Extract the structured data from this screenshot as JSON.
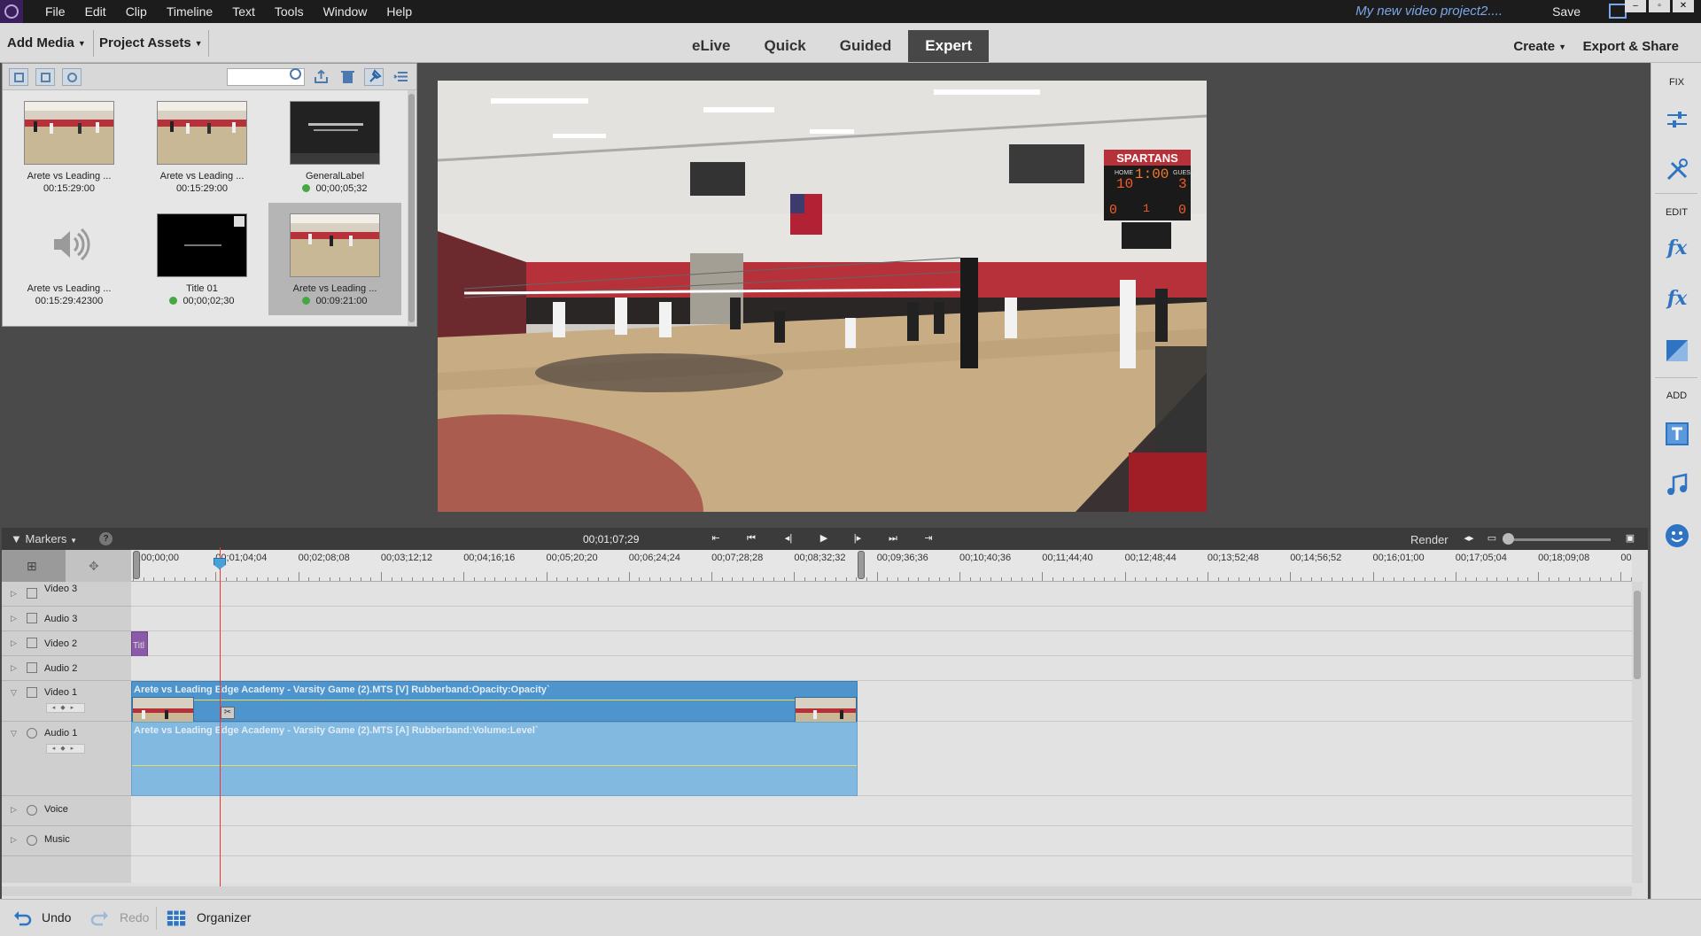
{
  "menu": {
    "items": [
      "File",
      "Edit",
      "Clip",
      "Timeline",
      "Text",
      "Tools",
      "Window",
      "Help"
    ],
    "project_name": "My new video project2....",
    "save": "Save"
  },
  "modebar": {
    "add_media": "Add Media",
    "project_assets": "Project Assets",
    "tabs": [
      "eLive",
      "Quick",
      "Guided",
      "Expert"
    ],
    "active_tab": "Expert",
    "create": "Create",
    "export_share": "Export & Share"
  },
  "assets": {
    "items": [
      {
        "name": "Arete vs Leading ...",
        "duration": "00:15:29:00",
        "kind": "video",
        "dot": false
      },
      {
        "name": "Arete vs Leading ...",
        "duration": "00:15:29:00",
        "kind": "video",
        "dot": false
      },
      {
        "name": "GeneralLabel",
        "duration": "00;00;05;32",
        "kind": "label",
        "dot": true
      },
      {
        "name": "Arete vs Leading ...",
        "duration": "00:15:29:42300",
        "kind": "audio",
        "dot": false
      },
      {
        "name": "Title 01",
        "duration": "00;00;02;30",
        "kind": "title",
        "dot": true
      },
      {
        "name": "Arete vs Leading ...",
        "duration": "00:09:21:00",
        "kind": "video",
        "dot": true
      }
    ],
    "selected_index": 5
  },
  "monitor": {
    "scoreboard": {
      "team": "SPARTANS",
      "home_label": "HOME",
      "guest_label": "GUEST",
      "home_score": "10",
      "guest_score": "3",
      "clock": "1:00",
      "home_sets": "0",
      "period": "1",
      "guest_sets": "0"
    }
  },
  "right_panel": {
    "fix_label": "FIX",
    "edit_label": "EDIT",
    "add_label": "ADD",
    "icons": [
      "adjustments-icon",
      "tools-icon",
      "applied-effects-icon",
      "effects-icon",
      "transitions-icon",
      "titles-icon",
      "music-icon",
      "graphics-icon"
    ]
  },
  "timeline": {
    "markers_label": "Markers",
    "help": "?",
    "timecode": "00;01;07;29",
    "render": "Render",
    "ruler": [
      "0;00;00;00",
      "00;01;04;04",
      "00;02;08;08",
      "00;03;12;12",
      "00;04;16;16",
      "00;05;20;20",
      "00;06;24;24",
      "00;07;28;28",
      "00;08;32;32",
      "00;09;36;36",
      "00;10;40;36",
      "00;11;44;40",
      "00;12;48;44",
      "00;13;52;48",
      "00;14;56;52",
      "00;16;01;00",
      "00;17;05;04",
      "00;18;09;08",
      "00"
    ],
    "tracks": [
      {
        "name": "Video 3",
        "type": "video"
      },
      {
        "name": "Audio 3",
        "type": "audio"
      },
      {
        "name": "Video 2",
        "type": "video"
      },
      {
        "name": "Audio 2",
        "type": "audio"
      },
      {
        "name": "Video 1",
        "type": "video"
      },
      {
        "name": "Audio 1",
        "type": "audio"
      },
      {
        "name": "Voice",
        "type": "voice"
      },
      {
        "name": "Music",
        "type": "music"
      }
    ],
    "title_clip": "Titl",
    "video_clip_label": "Arete vs Leading Edge Academy - Varsity Game (2).MTS [V] Rubberband:Opacity:Opacity`",
    "audio_clip_label": "Arete vs Leading Edge Academy - Varsity Game (2).MTS [A] Rubberband:Volume:Level`"
  },
  "bottombar": {
    "undo": "Undo",
    "redo": "Redo",
    "organizer": "Organizer"
  }
}
